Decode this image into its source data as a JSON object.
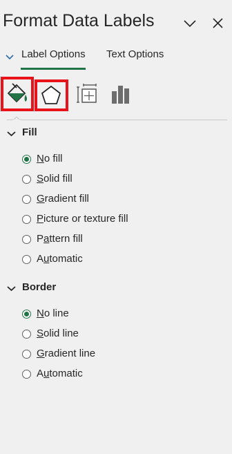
{
  "pane": {
    "title": "Format Data Labels"
  },
  "tabs": {
    "active_label": "Label Options",
    "inactive_label": "Text Options"
  },
  "category_icons": [
    "fill-line-icon",
    "effects-pentagon-icon",
    "size-properties-icon",
    "label-options-bars-icon"
  ],
  "colors": {
    "accent": "#217346",
    "highlight": "#e8131a",
    "background": "#f0f0f0"
  },
  "fill": {
    "title": "Fill",
    "options": [
      {
        "key": "N",
        "rest": "o fill",
        "checked": true
      },
      {
        "key": "S",
        "rest": "olid fill",
        "checked": false
      },
      {
        "key": "G",
        "rest": "radient fill",
        "checked": false
      },
      {
        "key": "P",
        "rest": "icture or texture fill",
        "checked": false
      },
      {
        "pre": "P",
        "key": "a",
        "rest": "ttern fill",
        "checked": false
      },
      {
        "pre": "A",
        "key": "u",
        "rest": "tomatic",
        "checked": false
      }
    ]
  },
  "border": {
    "title": "Border",
    "options": [
      {
        "key": "N",
        "rest": "o line",
        "checked": true
      },
      {
        "key": "S",
        "rest": "olid line",
        "checked": false
      },
      {
        "key": "G",
        "rest": "radient line",
        "checked": false
      },
      {
        "pre": "A",
        "key": "u",
        "rest": "tomatic",
        "checked": false
      }
    ]
  }
}
